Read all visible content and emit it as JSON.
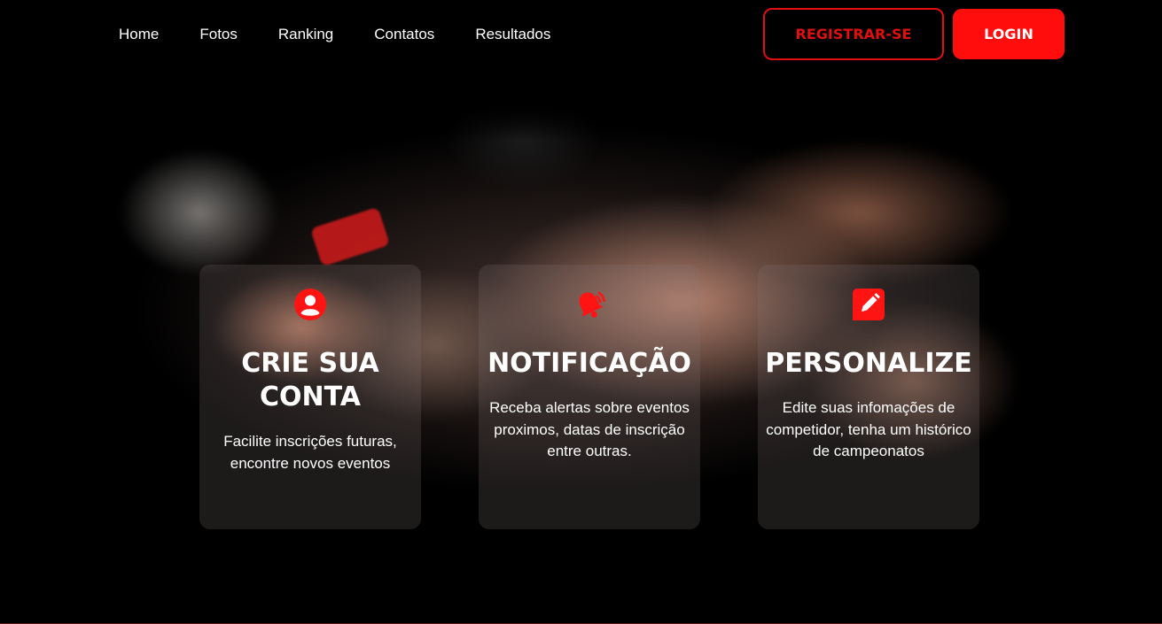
{
  "nav": {
    "links": [
      "Home",
      "Fotos",
      "Ranking",
      "Contatos",
      "Resultados"
    ],
    "register_label": "REGISTRAR-SE",
    "login_label": "LOGIN"
  },
  "hero": {
    "image_icon": "mma-fight-photo"
  },
  "cards": [
    {
      "icon": "user-circle-icon",
      "title": "CRIE SUA\nCONTA",
      "text": "Facilite inscrições futuras,\nencontre novos eventos"
    },
    {
      "icon": "bell-ringing-icon",
      "title": "NOTIFICAÇÃO",
      "text": "Receba alertas sobre eventos\nproximos, datas de inscrição\nentre outras."
    },
    {
      "icon": "edit-square-icon",
      "title": "PERSONALIZE",
      "text": "Edite suas infomações de\ncompetidor, tenha um histórico\nde campeonatos"
    }
  ],
  "colors": {
    "accent": "#ff0d0d",
    "background": "#000000"
  }
}
